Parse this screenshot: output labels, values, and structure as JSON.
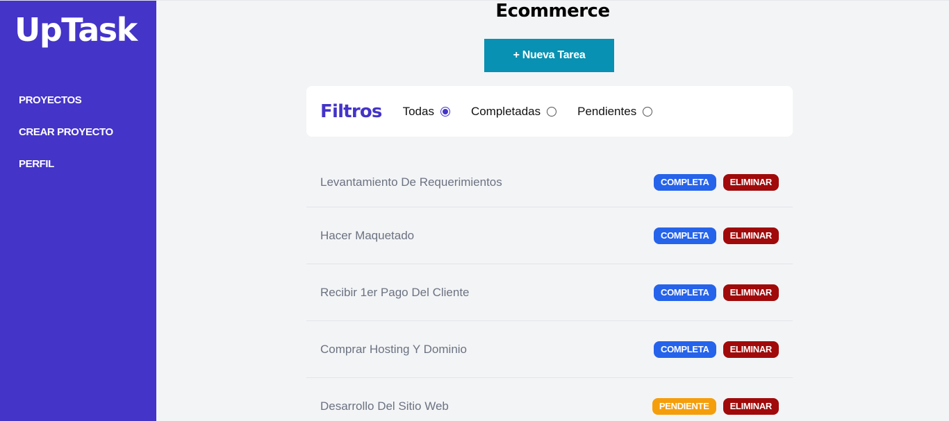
{
  "sidebar": {
    "logo": "UpTask",
    "nav": [
      {
        "label": "PROYECTOS"
      },
      {
        "label": "CREAR PROYECTO"
      },
      {
        "label": "PERFIL"
      }
    ]
  },
  "main": {
    "project_title": "Ecommerce",
    "new_task_label": "+ Nueva Tarea",
    "filters": {
      "title": "Filtros",
      "options": [
        {
          "label": "Todas",
          "checked": true
        },
        {
          "label": "Completadas",
          "checked": false
        },
        {
          "label": "Pendientes",
          "checked": false
        }
      ]
    },
    "tasks": [
      {
        "name": "Levantamiento De Requerimientos",
        "status": "COMPLETA",
        "delete": "ELIMINAR"
      },
      {
        "name": "Hacer Maquetado",
        "status": "COMPLETA",
        "delete": "ELIMINAR"
      },
      {
        "name": "Recibir 1er Pago Del Cliente",
        "status": "COMPLETA",
        "delete": "ELIMINAR"
      },
      {
        "name": "Comprar Hosting Y Dominio",
        "status": "COMPLETA",
        "delete": "ELIMINAR"
      },
      {
        "name": "Desarrollo Del Sitio Web",
        "status": "PENDIENTE",
        "delete": "ELIMINAR"
      }
    ]
  },
  "colors": {
    "sidebar_bg": "#4434c8",
    "new_task_button": "#0891b2",
    "complete_badge": "#2563eb",
    "pending_badge": "#f59e0b",
    "delete_badge": "#a10a0a",
    "page_bg": "#f3f4f6"
  }
}
